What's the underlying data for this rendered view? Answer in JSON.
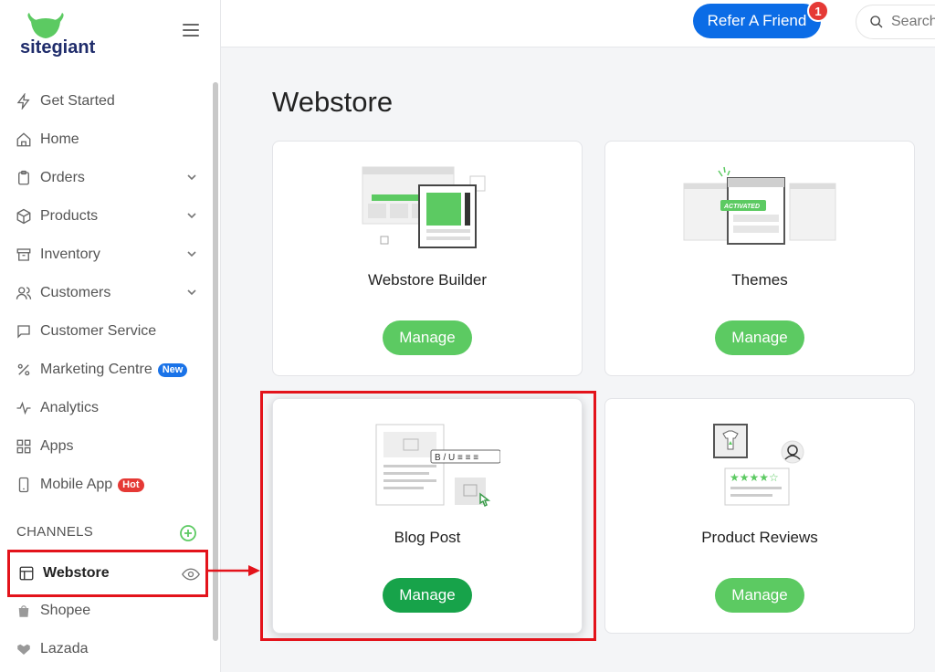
{
  "brand": {
    "name": "sitegiant",
    "accent": "#5cca62"
  },
  "sidebar": {
    "items": [
      {
        "label": "Get Started",
        "icon": "bolt-icon"
      },
      {
        "label": "Home",
        "icon": "home-icon"
      },
      {
        "label": "Orders",
        "icon": "clipboard-icon"
      },
      {
        "label": "Products",
        "icon": "box-icon"
      },
      {
        "label": "Inventory",
        "icon": "archive-icon"
      },
      {
        "label": "Customers",
        "icon": "users-icon"
      },
      {
        "label": "Customer Service",
        "icon": "chat-icon"
      },
      {
        "label": "Marketing Centre",
        "icon": "percent-icon",
        "badge": "New"
      },
      {
        "label": "Analytics",
        "icon": "pulse-icon"
      },
      {
        "label": "Apps",
        "icon": "grid-icon"
      },
      {
        "label": "Mobile App",
        "icon": "phone-icon",
        "badge": "Hot"
      }
    ],
    "channels_label": "CHANNELS",
    "channels": [
      {
        "label": "Webstore",
        "icon": "layout-icon"
      },
      {
        "label": "Shopee",
        "icon": "shopee-icon"
      },
      {
        "label": "Lazada",
        "icon": "lazada-icon"
      }
    ]
  },
  "topbar": {
    "refer_label": "Refer A Friend",
    "notification_count": "1",
    "search_placeholder": "Search"
  },
  "main": {
    "title": "Webstore",
    "cards": [
      {
        "title": "Webstore Builder",
        "button": "Manage"
      },
      {
        "title": "Themes",
        "button": "Manage",
        "tag": "ACTIVATED"
      },
      {
        "title": "Blog Post",
        "button": "Manage"
      },
      {
        "title": "Product Reviews",
        "button": "Manage"
      }
    ]
  }
}
